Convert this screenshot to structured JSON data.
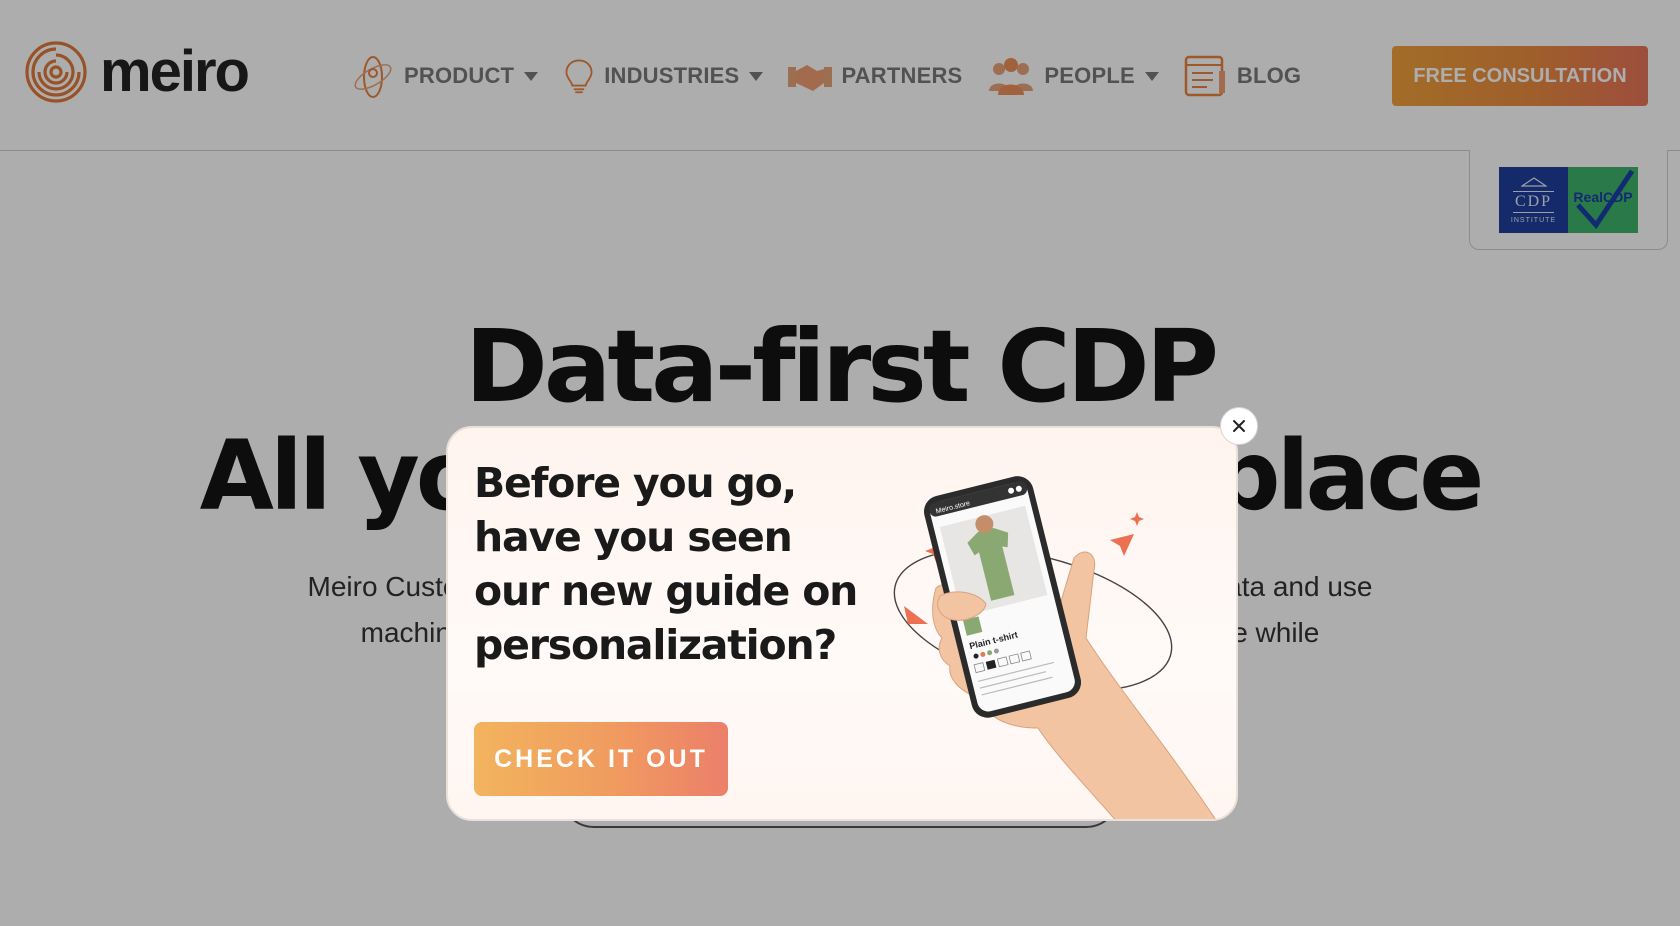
{
  "brand": {
    "name": "meiro",
    "accent": "#e8843f"
  },
  "nav": {
    "items": [
      {
        "label": "PRODUCT",
        "icon": "rocket-icon",
        "dropdown": true
      },
      {
        "label": "INDUSTRIES",
        "icon": "lightbulb-icon",
        "dropdown": true
      },
      {
        "label": "PARTNERS",
        "icon": "handshake-icon",
        "dropdown": false
      },
      {
        "label": "PEOPLE",
        "icon": "people-icon",
        "dropdown": true
      },
      {
        "label": "BLOG",
        "icon": "blog-icon",
        "dropdown": false
      }
    ],
    "cta_label": "FREE CONSULTATION"
  },
  "badge": {
    "left": "CDP",
    "left_small": "INSTITUTE",
    "right": "RealCDP"
  },
  "hero": {
    "title_line1": "Data-first CDP",
    "title_line2": "All your data in one place",
    "subtitle_line1": "Meiro Customer Data Platform lets you collect and unify your customers’ data and use",
    "subtitle_line2": "machine learning to personalize and improve your customer experience while"
  },
  "modal": {
    "title": "Before you go, have you seen our new guide on personalization?",
    "cta_label": "CHECK IT OUT",
    "phone_store": "Meiro.store",
    "phone_product": "Plain t-shirt"
  }
}
